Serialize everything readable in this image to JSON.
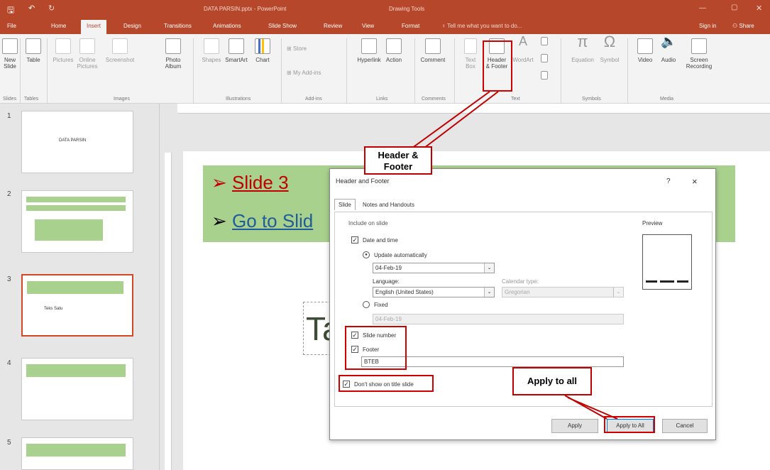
{
  "titlebar": {
    "filename": "DATA PARSIN.pptx - PowerPoint",
    "context": "Drawing Tools"
  },
  "tabs": [
    "File",
    "Home",
    "Insert",
    "Design",
    "Transitions",
    "Animations",
    "Slide Show",
    "Review",
    "View",
    "Format"
  ],
  "tellme": "Tell me what you want to do...",
  "signin": "Sign in",
  "share": "Share",
  "ribbon": {
    "buttons": [
      {
        "label": "New\nSlide"
      },
      {
        "label": "Table"
      },
      {
        "label": "Pictures"
      },
      {
        "label": "Online\nPictures"
      },
      {
        "label": "Screenshot"
      },
      {
        "label": "Photo\nAlbum"
      },
      {
        "label": "Shapes"
      },
      {
        "label": "SmartArt"
      },
      {
        "label": "Chart"
      },
      {
        "label": "Store"
      },
      {
        "label": "My Add-ins"
      },
      {
        "label": "Hyperlink"
      },
      {
        "label": "Action"
      },
      {
        "label": "Comment"
      },
      {
        "label": "Text\nBox"
      },
      {
        "label": "Header\n& Footer"
      },
      {
        "label": "WordArt"
      },
      {
        "label": "Equation"
      },
      {
        "label": "Symbol"
      },
      {
        "label": "Video"
      },
      {
        "label": "Audio"
      },
      {
        "label": "Screen\nRecording"
      }
    ],
    "groups": [
      "Slides",
      "Tables",
      "Images",
      "Illustrations",
      "Add-ins",
      "Links",
      "Comments",
      "Text",
      "Symbols",
      "Media"
    ]
  },
  "thumbnails": [
    {
      "num": "1",
      "text": "DATA PARSIN"
    },
    {
      "num": "2",
      "text": ""
    },
    {
      "num": "3",
      "text": "Teks Satu"
    },
    {
      "num": "4",
      "text": ""
    },
    {
      "num": "5",
      "text": ""
    }
  ],
  "slide": {
    "bullet1": "Slide 3",
    "bullet2": "Go to Slid",
    "bigtext": "Ta"
  },
  "dialog": {
    "title": "Header and Footer",
    "help": "?",
    "close": "×",
    "tab_slide": "Slide",
    "tab_notes": "Notes and Handouts",
    "include_label": "Include on slide",
    "date_time": "Date and time",
    "update_auto": "Update automatically",
    "date_value": "04-Feb-19",
    "language_label": "Language:",
    "language_value": "English (United States)",
    "calendar_label": "Calendar type:",
    "calendar_value": "Gregorian",
    "fixed": "Fixed",
    "fixed_value": "04-Feb-19",
    "slide_number": "Slide number",
    "footer": "Footer",
    "footer_value": "BTEB",
    "dont_show": "Don't show on title slide",
    "preview": "Preview",
    "apply": "Apply",
    "apply_all": "Apply to All",
    "cancel": "Cancel"
  },
  "callouts": {
    "header_footer": "Header & Footer",
    "apply_all": "Apply to all"
  },
  "colors": {
    "accent": "#b7472a",
    "highlight": "#d00000",
    "slide_green": "#a9d18e"
  }
}
